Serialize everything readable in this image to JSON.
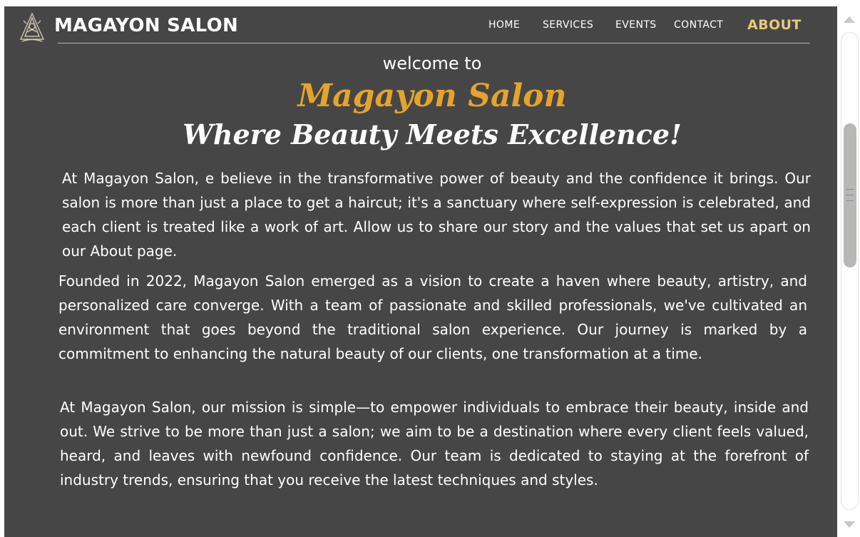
{
  "header": {
    "brand_name": "MAGAYON SALON",
    "logo_icon": "salon-logo-icon",
    "nav": [
      {
        "label": "HOME",
        "active": false
      },
      {
        "label": "SERVICES",
        "active": false
      },
      {
        "label": "EVENTS",
        "active": false
      },
      {
        "label": "CONTACT",
        "active": false
      },
      {
        "label": "ABOUT",
        "active": true
      }
    ]
  },
  "hero": {
    "welcome": "welcome to",
    "salon_name": "Magayon Salon",
    "tagline": "Where Beauty Meets Excellence!"
  },
  "content": {
    "paragraphs": [
      "At Magayon Salon, e believe in the transformative power of beauty and the confidence it brings. Our salon is more than just a place to get a haircut; it's a sanctuary where self-expression is celebrated, and each client is treated like a work of art. Allow us to share our story and the values that set us apart on our About page.",
      "Founded in 2022, Magayon Salon emerged as a vision to create a haven where beauty, artistry, and personalized care converge. With a team of passionate and skilled professionals, we've cultivated an environment that goes beyond the traditional salon experience. Our journey is marked by a commitment to enhancing the natural beauty of our clients, one transformation at a time.",
      "At Magayon Salon, our mission is simple—to empower individuals to embrace their beauty, inside and out. We strive to be more than just a salon; we aim to be a destination where every client feels valued, heard, and leaves with newfound confidence. Our team is dedicated to staying at the forefront of industry trends, ensuring that you receive the latest techniques and styles."
    ]
  },
  "colors": {
    "page_background": "#464646",
    "accent_gold": "#e4a42b",
    "active_nav": "#e6c979",
    "text": "#ffffff"
  }
}
